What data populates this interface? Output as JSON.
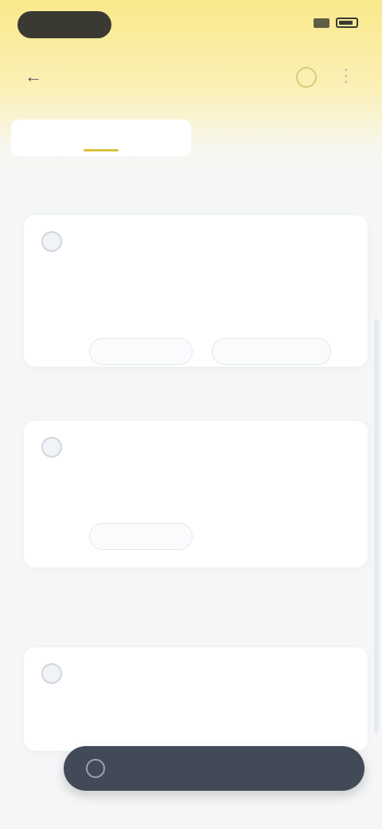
{
  "status": {},
  "header": {},
  "tabs": [],
  "sections": [],
  "cta": {}
}
